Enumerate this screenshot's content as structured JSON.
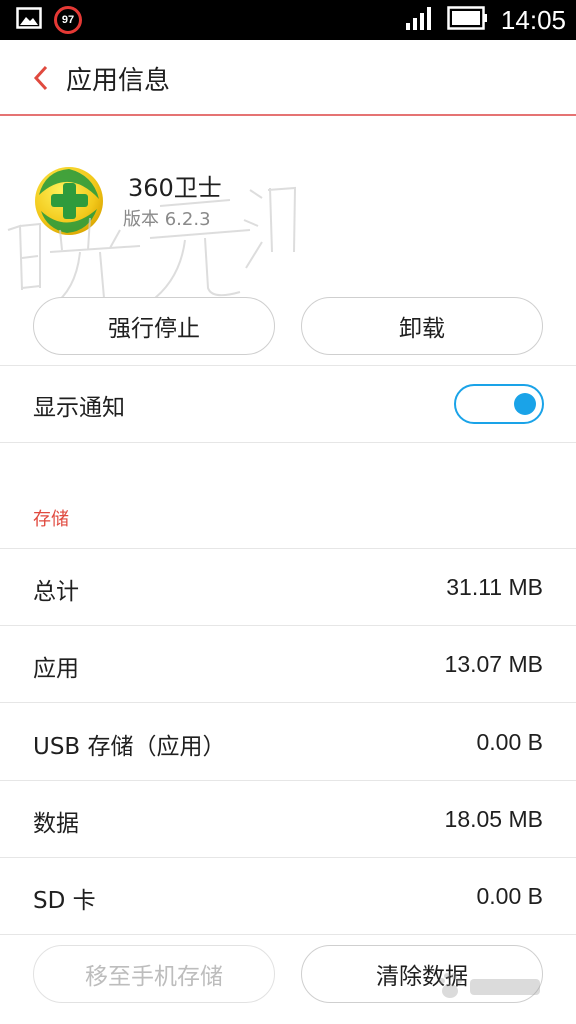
{
  "status_bar": {
    "notification_badge": "97",
    "time": "14:05"
  },
  "header": {
    "title": "应用信息"
  },
  "app": {
    "name": "360卫士",
    "version": "版本 6.2.3"
  },
  "actions": {
    "force_stop": "强行停止",
    "uninstall": "卸载"
  },
  "notifications": {
    "label": "显示通知",
    "enabled": true
  },
  "storage": {
    "section_title": "存储",
    "rows": [
      {
        "label": "总计",
        "value": "31.11 MB"
      },
      {
        "label": "应用",
        "value": "13.07 MB"
      },
      {
        "label": "USB 存储（应用）",
        "value": "0.00 B"
      },
      {
        "label": "数据",
        "value": "18.05 MB"
      },
      {
        "label": "SD 卡",
        "value": "0.00 B"
      }
    ],
    "move_button": "移至手机存储",
    "clear_button": "清除数据"
  },
  "colors": {
    "accent_red": "#e04a3f",
    "toggle_blue": "#1aa3e8",
    "status_bar_bg": "#000000"
  }
}
